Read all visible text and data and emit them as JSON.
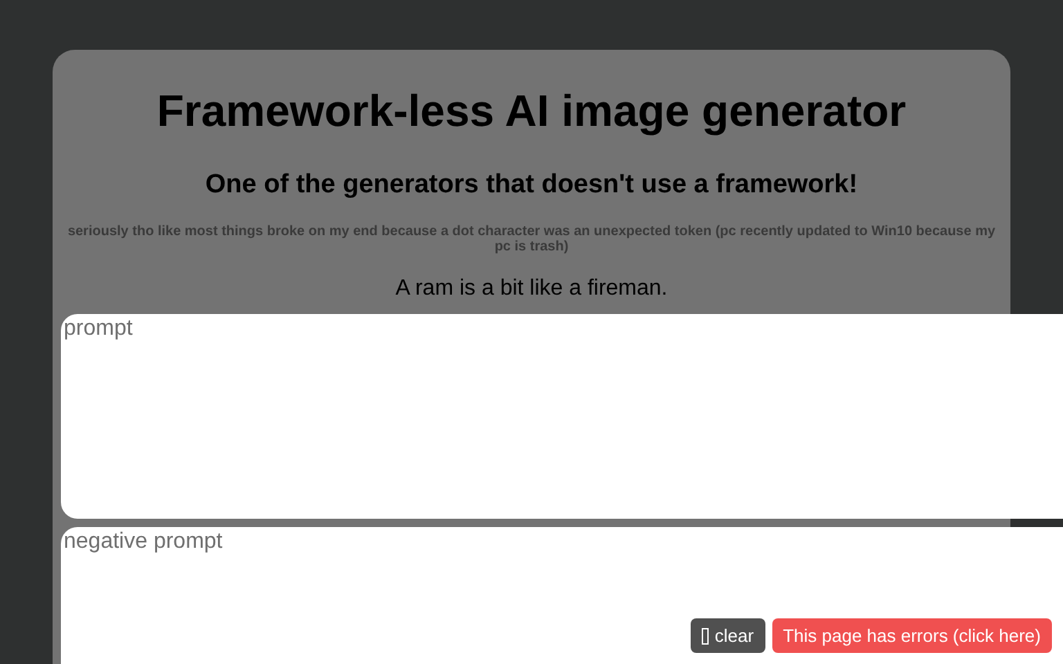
{
  "title": "Framework-less AI image generator",
  "subtitle": "One of the generators that doesn't use a framework!",
  "note": "seriously tho like most things broke on my end because a dot character was an unexpected token (pc recently updated to Win10 because my pc is trash)",
  "tagline": "A ram is a bit like a fireman.",
  "prompt": {
    "placeholder": "prompt"
  },
  "negative_prompt": {
    "placeholder": "negative prompt"
  },
  "clear_button": "clear",
  "error_button": "This page has errors (click here)"
}
